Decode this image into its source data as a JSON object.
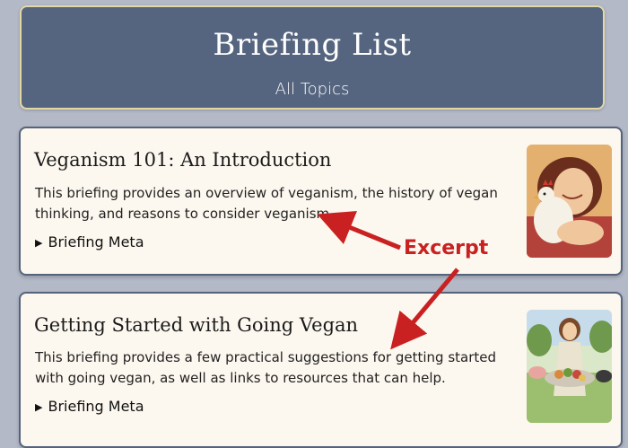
{
  "header": {
    "title": "Briefing List",
    "subtitle": "All Topics"
  },
  "briefings": [
    {
      "title": "Veganism 101: An Introduction",
      "excerpt": "This briefing provides an overview of veganism, the history of vegan thinking, and reasons to consider veganism.",
      "meta_label": "Briefing Meta",
      "thumbnail": "woman-hugging-chicken-illustration"
    },
    {
      "title": "Getting Started with Going Vegan",
      "excerpt": "This briefing provides a few practical suggestions for getting started with going vegan, as well as links to resources that can help.",
      "meta_label": "Briefing Meta",
      "thumbnail": "woman-holding-vegan-food-platter-illustration"
    }
  ],
  "annotation": {
    "label": "Excerpt",
    "color": "#c92121"
  }
}
